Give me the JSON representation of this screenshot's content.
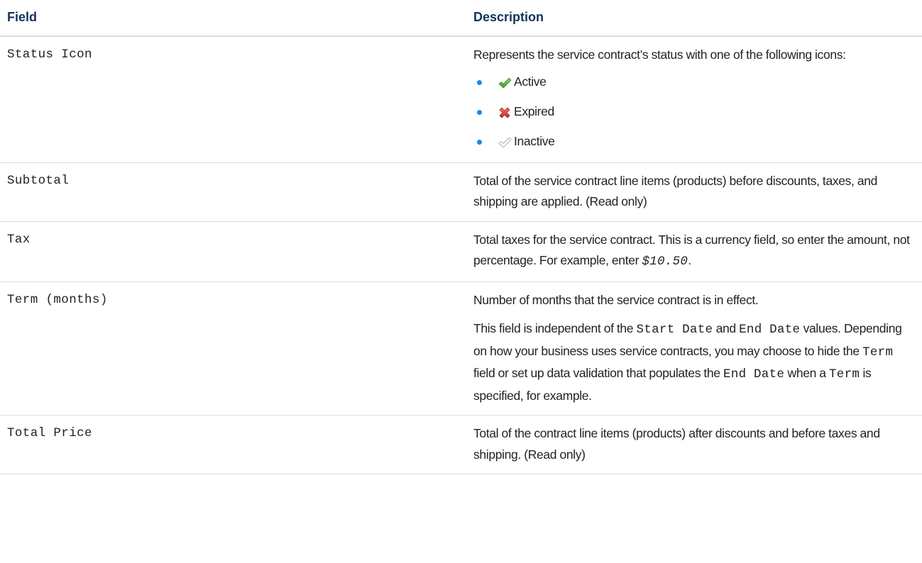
{
  "table": {
    "headers": {
      "field": "Field",
      "description": "Description"
    },
    "rows": {
      "status_icon": {
        "field": "Status Icon",
        "desc": "Represents the service contract’s status with one of the following icons:",
        "statuses": [
          {
            "icon": "active-check-icon",
            "label": "Active",
            "color": "#4bca81"
          },
          {
            "icon": "expired-x-icon",
            "label": "Expired",
            "color": "#e35d5b"
          },
          {
            "icon": "inactive-check-icon",
            "label": "Inactive",
            "color": "#c9c9c9"
          }
        ]
      },
      "subtotal": {
        "field": "Subtotal",
        "desc": "Total of the service contract line items (products) before discounts, taxes, and shipping are applied. (Read only)"
      },
      "tax": {
        "field": "Tax",
        "desc_before": "Total taxes for the service contract. This is a currency field, so enter the amount, not percentage. For example, enter ",
        "desc_example": "$10.50",
        "desc_after": "."
      },
      "term": {
        "field": "Term (months)",
        "desc_p1": "Number of months that the service contract is in effect.",
        "p2": {
          "t1": "This field is independent of the ",
          "c1": "Start Date",
          "t2": " and ",
          "c2": "End Date",
          "t3": " values. Depending on how your business uses service contracts, you may choose to hide the ",
          "c3": "Term",
          "t4": " field or set up data validation that populates the ",
          "c4": "End Date",
          "t5": " when a ",
          "c5": "Term",
          "t6": " is specified, for example."
        }
      },
      "total_price": {
        "field": "Total Price",
        "desc": "Total of the contract line items (products) after discounts and before taxes and shipping. (Read only)"
      }
    }
  },
  "colors": {
    "header_text": "#16325c",
    "bullet": "#1589ee",
    "divider": "#d8dde6"
  }
}
